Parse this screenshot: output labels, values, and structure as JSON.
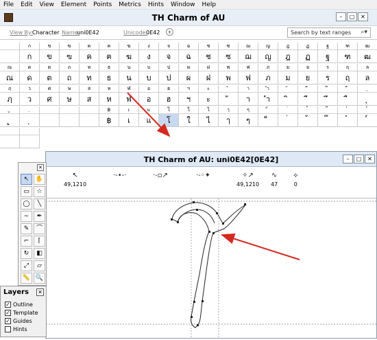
{
  "menu": [
    "File",
    "Edit",
    "View",
    "Element",
    "Points",
    "Metrics",
    "Hints",
    "Window",
    "Help"
  ],
  "font_window": {
    "title": "TH Charm of AU"
  },
  "infobar": {
    "view_by_label": "View By:",
    "view_by_value": "Character",
    "name_label": "Name:",
    "name_value": "uni0E42",
    "unicode_label": "Unicode:",
    "unicode_value": "0E42",
    "search_placeholder": "Search by text ranges"
  },
  "grid_rows": [
    {
      "hdr": [
        "",
        "ก",
        "ข",
        "ฃ",
        "ค",
        "ฅ",
        "ฆ",
        "ง",
        "จ",
        "ฉ",
        "ช",
        "ซ",
        "ฌ",
        "ญ",
        "ฎ",
        "ฏ",
        "ฐ",
        "ฑ",
        "ฒ"
      ],
      "gl": [
        "",
        "ก",
        "ข",
        "ฃ",
        "ค",
        "ฅ",
        "ฆ",
        "ง",
        "จ",
        "ฉ",
        "ช",
        "ซ",
        "ฌ",
        "ญ",
        "ฎ",
        "ฏ",
        "ฐ",
        "ฑ",
        "ฒ"
      ]
    },
    {
      "hdr": [
        "ณ",
        "ด",
        "ต",
        "ถ",
        "ท",
        "ธ",
        "น",
        "บ",
        "ป",
        "ผ",
        "ฝ",
        "พ",
        "ฟ",
        "ภ",
        "ม",
        "ย",
        "ร",
        "ฤ",
        "ล"
      ],
      "gl": [
        "ณ",
        "ด",
        "ต",
        "ถ",
        "ท",
        "ธ",
        "น",
        "บ",
        "ป",
        "ผ",
        "ฝ",
        "พ",
        "ฟ",
        "ภ",
        "ม",
        "ย",
        "ร",
        "ฤ",
        "ล"
      ]
    },
    {
      "hdr": [
        "ฦ",
        "ว",
        "ศ",
        "ษ",
        "ส",
        "ห",
        "ฬ",
        "อ",
        "ฮ",
        "ฯ",
        "ะ",
        "ั",
        "า",
        "ำ",
        "ิ",
        "ี",
        "ึ",
        "ื",
        "ุ"
      ],
      "gl": [
        "ฦ",
        "ว",
        "ศ",
        "ษ",
        "ส",
        "ห",
        "ฬ",
        "อ",
        "ฮ",
        "ฯ",
        "ะ",
        "ั",
        "า",
        "ำ",
        "ิ",
        "ี",
        "ึ",
        "ื",
        "ุ"
      ]
    },
    {
      "hdr": [
        "ู",
        "ฺ",
        "",
        "",
        "",
        "฿",
        "เ",
        "แ",
        "โ",
        "ใ",
        "ไ",
        "ๅ",
        "ๆ",
        "็",
        "่",
        "้",
        "๊",
        "๋",
        "์"
      ],
      "gl": [
        "ู",
        "ฺ",
        "",
        "",
        "",
        "฿",
        "เ",
        "แ",
        "โ",
        "ใ",
        "ไ",
        "ๅ",
        "ๆ",
        "็",
        "่",
        "้",
        "๊",
        "๋",
        "์"
      ]
    }
  ],
  "layers": {
    "title": "Layers",
    "items": [
      {
        "label": "Outline",
        "checked": true
      },
      {
        "label": "Template",
        "checked": true
      },
      {
        "label": "Guides",
        "checked": true
      },
      {
        "label": "Hints",
        "checked": false
      }
    ]
  },
  "editor": {
    "title": "TH Charm of AU: uni0E42[0E42]",
    "toolbar": [
      {
        "icon": "pointer-icon",
        "value": "49,1210"
      },
      {
        "icon": "curve-point-icon",
        "value": ""
      },
      {
        "icon": "corner-point-icon",
        "value": ""
      },
      {
        "icon": "tangent-point-icon",
        "value": ""
      },
      {
        "icon": "measure-icon",
        "value": "49,1210"
      },
      {
        "icon": "spiro-icon",
        "value": "47"
      },
      {
        "icon": "angle-icon",
        "value": "0"
      }
    ]
  },
  "colors": {
    "selection": "#c8d8f0",
    "arrow": "#d42a20",
    "titlebar": "#dfe9f5"
  }
}
